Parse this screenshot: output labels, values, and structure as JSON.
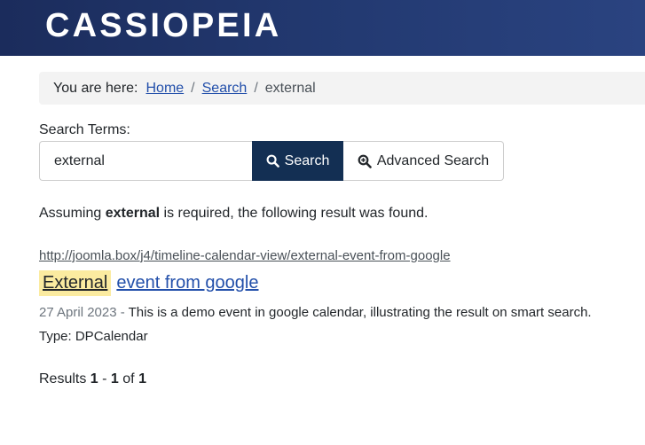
{
  "header": {
    "logo_text": "CASSIOPEIA",
    "colors": {
      "bg_dark": "#1b2c5c",
      "bg_light": "#2a4380"
    }
  },
  "breadcrumb": {
    "prefix": "You are here:",
    "items": [
      {
        "label": "Home",
        "link": true
      },
      {
        "label": "Search",
        "link": true
      },
      {
        "label": "external",
        "link": false
      }
    ],
    "separator": "/"
  },
  "search": {
    "label": "Search Terms:",
    "value": "external",
    "search_button": {
      "label": "Search",
      "icon": "search-icon"
    },
    "advanced_button": {
      "label": "Advanced Search",
      "icon": "zoom-in-icon"
    },
    "accent_color": "#132f53"
  },
  "message": {
    "before": "Assuming ",
    "term": "external",
    "after": " is required, the following result was found."
  },
  "results": [
    {
      "url": "http://joomla.box/j4/timeline-calendar-view/external-event-from-google",
      "title_highlight": "External",
      "title_rest": "event from google",
      "date": "27 April 2023",
      "date_sep": " - ",
      "description": "This is a demo event in google calendar, illustrating the result on smart search.",
      "type": "Type: DPCalendar"
    }
  ],
  "pagination": {
    "prefix": "Results ",
    "start": "1",
    "dash": " - ",
    "end": "1",
    "of": " of ",
    "total": "1"
  }
}
